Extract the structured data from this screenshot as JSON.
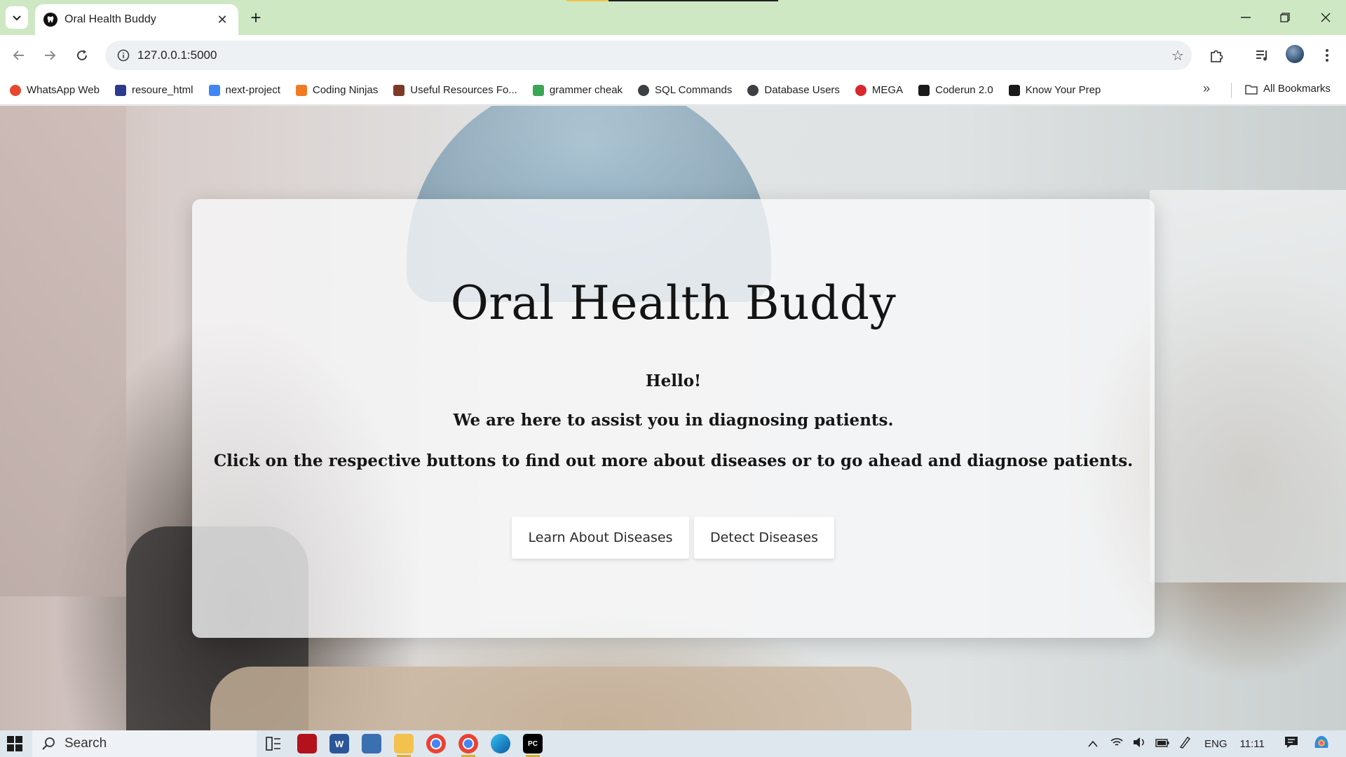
{
  "browser": {
    "tab_title": "Oral Health Buddy",
    "url": "127.0.0.1:5000",
    "bookmarks": [
      {
        "label": "WhatsApp Web",
        "icon": "whatsapp-icon",
        "color": "#e8472f"
      },
      {
        "label": "resoure_html",
        "icon": "book-icon",
        "color": "#2b3a8c"
      },
      {
        "label": "next-project",
        "icon": "google-icon",
        "color": "#4285f4"
      },
      {
        "label": "Coding Ninjas",
        "icon": "coding-ninjas-icon",
        "color": "#f07a22"
      },
      {
        "label": "Useful Resources Fo...",
        "icon": "cc-icon",
        "color": "#7a3a25"
      },
      {
        "label": "grammer cheak",
        "icon": "robot-icon",
        "color": "#3aa757"
      },
      {
        "label": "SQL Commands",
        "icon": "globe-icon",
        "color": "#3c4043"
      },
      {
        "label": "Database Users",
        "icon": "globe-icon",
        "color": "#3c4043"
      },
      {
        "label": "MEGA",
        "icon": "mega-icon",
        "color": "#d9272e"
      },
      {
        "label": "Coderun 2.0",
        "icon": "coderun-icon",
        "color": "#1a1a1a"
      },
      {
        "label": "Know Your Prep",
        "icon": "coderun-icon",
        "color": "#1a1a1a"
      }
    ],
    "all_bookmarks_label": "All Bookmarks"
  },
  "page": {
    "title": "Oral Health Buddy",
    "hello": "Hello!",
    "assist": "We are here to assist you in diagnosing patients.",
    "instructions": "Click on the respective buttons to find out more about diseases or to go ahead and diagnose patients.",
    "learn_button": "Learn About Diseases",
    "detect_button": "Detect Diseases"
  },
  "taskbar": {
    "search_label": "Search",
    "language": "ENG",
    "time": "11:11"
  },
  "colors": {
    "tabstrip": "#cfe8c4",
    "card_background": "rgba(248,248,250,0.78)",
    "taskbar": "#dfe7ee"
  }
}
